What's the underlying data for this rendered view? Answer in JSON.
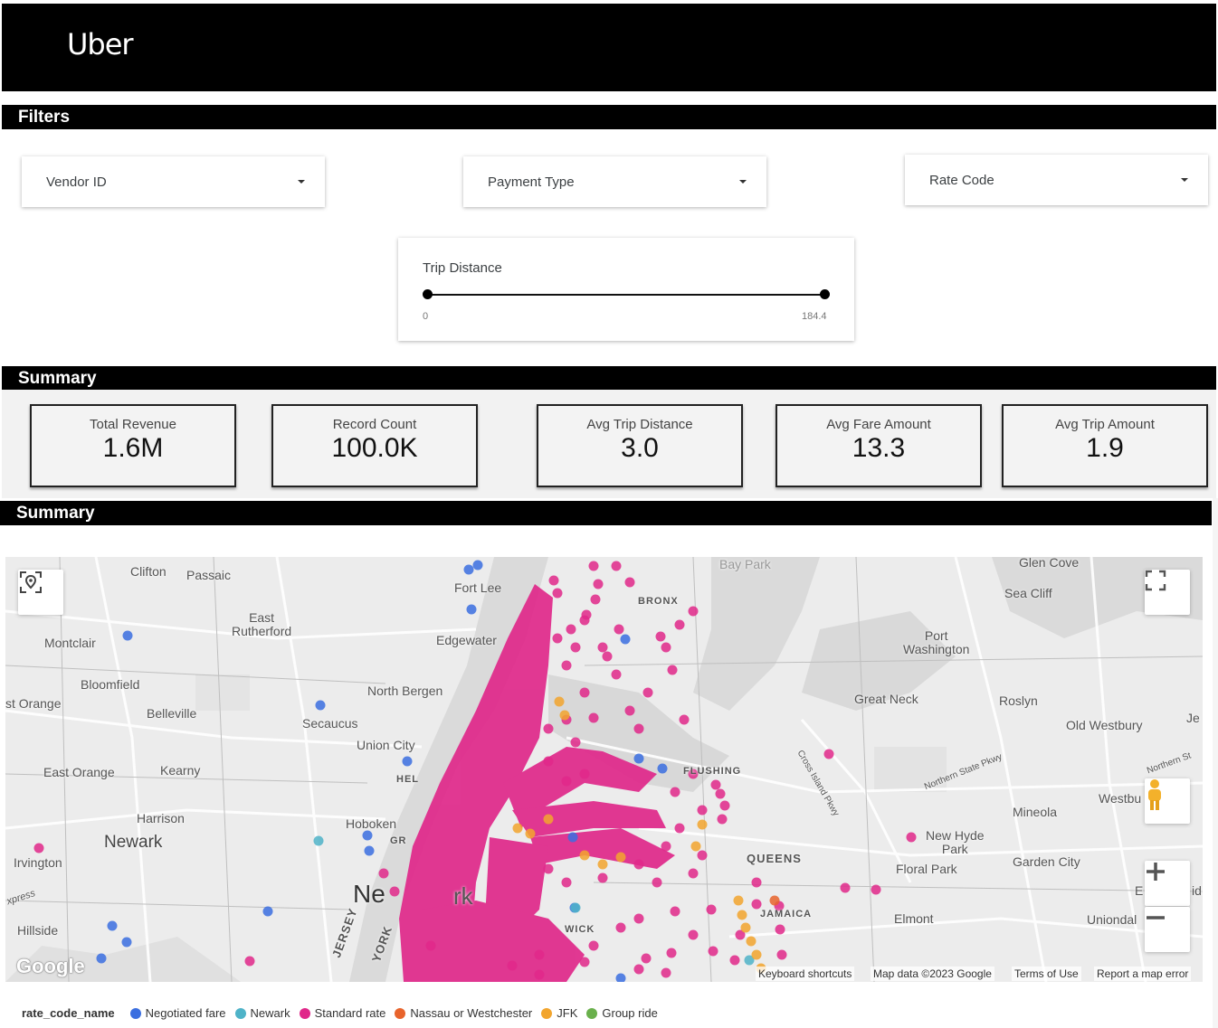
{
  "header": {
    "logo_text": "Uber"
  },
  "sections": {
    "filters_title": "Filters",
    "summary_title": "Summary",
    "map_title": "Summary"
  },
  "filters": {
    "vendor_id": "Vendor ID",
    "payment_type": "Payment Type",
    "rate_code": "Rate Code",
    "trip_distance": {
      "label": "Trip Distance",
      "min": "0",
      "max": "184.4"
    }
  },
  "kpis": [
    {
      "label": "Total Revenue",
      "value": "1.6M"
    },
    {
      "label": "Record Count",
      "value": "100.0K"
    },
    {
      "label": "Avg Trip Distance",
      "value": "3.0"
    },
    {
      "label": "Avg Fare Amount",
      "value": "13.3"
    },
    {
      "label": "Avg Trip Amount",
      "value": "1.9"
    }
  ],
  "map": {
    "places": {
      "clifton": "Clifton",
      "passaic": "Passaic",
      "montclair": "Montclair",
      "east_rutherford": "East\nRutherford",
      "fort_lee": "Fort Lee",
      "bronx": "BRONX",
      "bay_park": "Bay Park",
      "glen_cove": "Glen Cove",
      "sea_cliff": "Sea Cliff",
      "port_washington": "Port\nWashington",
      "edgewater": "Edgewater",
      "bloomfield": "Bloomfield",
      "orange": "st Orange",
      "belleville": "Belleville",
      "north_bergen": "North Bergen",
      "secaucus": "Secaucus",
      "great_neck": "Great Neck",
      "roslyn": "Roslyn",
      "old_westbury": "Old Westbury",
      "je": "Je",
      "union_city": "Union City",
      "hel": "HEL",
      "east_orange": "East Orange",
      "kearny": "Kearny",
      "flushing": "FLUSHING",
      "cross_island": "Cross Island Pkwy",
      "northern_state": "Northern State Pkwy",
      "northern_st": "Northern St",
      "mineola": "Mineola",
      "westbu": "Westbu",
      "harrison": "Harrison",
      "hoboken": "Hoboken",
      "gr": "GR",
      "newark": "Newark",
      "queens": "QUEENS",
      "new_hyde_park": "New Hyde\nPark",
      "garden_city": "Garden City",
      "irvington": "Irvington",
      "floral_park": "Floral Park",
      "new_york": "Ne",
      "rk": "rk",
      "jamaica": "JAMAICA",
      "elmont": "Elmont",
      "uniondal": "Uniondal",
      "express": "xpress",
      "hillside": "Hillside",
      "jersey": "JERSEY",
      "york": "YORK",
      "e": "E",
      "id": "id",
      "wick": "WICK"
    },
    "google_logo": "Google",
    "footer": {
      "keyboard": "Keyboard shortcuts",
      "map_data": "Map data ©2023 Google",
      "terms": "Terms of Use",
      "report": "Report a map error"
    }
  },
  "legend": {
    "title": "rate_code_name",
    "items": [
      {
        "label": "Negotiated fare",
        "color": "#3b6fe0"
      },
      {
        "label": "Newark",
        "color": "#4fb3c8"
      },
      {
        "label": "Standard rate",
        "color": "#e0288a"
      },
      {
        "label": "Nassau or Westchester",
        "color": "#e8642c"
      },
      {
        "label": "JFK",
        "color": "#f2a52e"
      },
      {
        "label": "Group ride",
        "color": "#6ab04c"
      }
    ]
  }
}
